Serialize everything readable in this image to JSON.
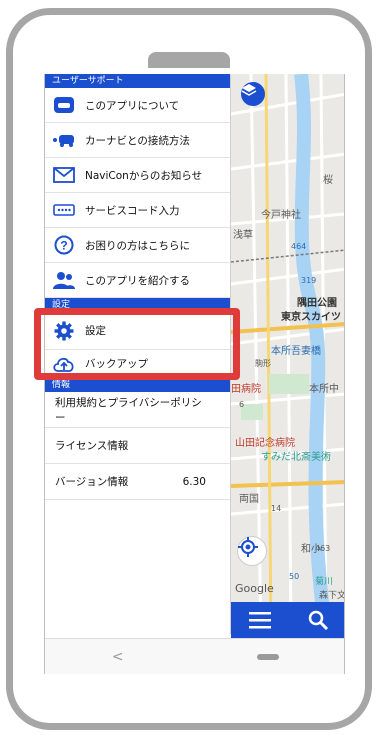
{
  "drawer": {
    "support_header": "ユーザーサポート",
    "support_items": [
      {
        "label": "このアプリについて",
        "icon": "car-app-icon"
      },
      {
        "label": "カーナビとの接続方法",
        "icon": "car-connect-icon"
      },
      {
        "label": "NaviConからのお知らせ",
        "icon": "envelope-icon"
      },
      {
        "label": "サービスコード入力",
        "icon": "code-input-icon"
      },
      {
        "label": "お困りの方はこちらに",
        "icon": "question-icon"
      },
      {
        "label": "このアプリを紹介する",
        "icon": "users-icon"
      }
    ],
    "settings_header": "設定",
    "settings_items": [
      {
        "label": "設定",
        "icon": "gear-icon"
      },
      {
        "label": "バックアップ",
        "icon": "cloud-upload-icon"
      }
    ],
    "info_header": "情報",
    "info_items": [
      {
        "label": "利用規約とプライバシーポリシー"
      },
      {
        "label": "ライセンス情報"
      },
      {
        "label": "バージョン情報",
        "value": "6.30"
      }
    ]
  },
  "map": {
    "labels": [
      "桜",
      "今戸神社",
      "浅草",
      "464",
      "319",
      "隅田公園",
      "東京スカイツ",
      "本所吾妻橋",
      "駒形",
      "田病院",
      "本所中",
      "山田記念病院",
      "すみだ北斎美術",
      "両国",
      "和小",
      "菊川",
      "森下文",
      "Google",
      "50",
      "14",
      "6",
      "463"
    ],
    "accent_color": "#1b4fd0"
  },
  "navbar": {
    "back_glyph": "<"
  },
  "colors": {
    "primary": "#1b4fd0",
    "highlight": "#e03b3b"
  }
}
